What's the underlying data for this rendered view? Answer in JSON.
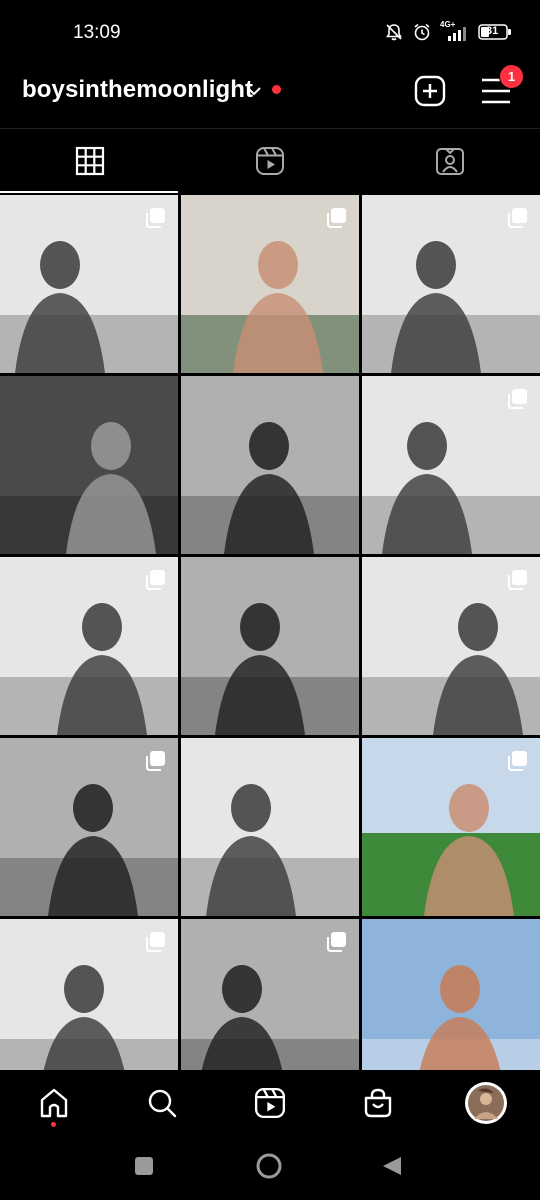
{
  "status_bar": {
    "time": "13:09",
    "network": "4G+",
    "battery": "31",
    "icons": [
      "bell-muted-icon",
      "alarm-icon",
      "signal-icon",
      "battery-icon"
    ]
  },
  "header": {
    "username": "boysinthemoonlight",
    "notification_count": "1",
    "icons": [
      "chevron-down-icon",
      "create-post-icon",
      "menu-icon"
    ]
  },
  "tabs": [
    {
      "icon": "grid-icon",
      "active": true
    },
    {
      "icon": "reels-icon",
      "active": false
    },
    {
      "icon": "tagged-icon",
      "active": false
    }
  ],
  "posts": [
    {
      "tone": "light-gray",
      "multi": true
    },
    {
      "tone": "color-warm",
      "multi": true
    },
    {
      "tone": "light-gray",
      "multi": true
    },
    {
      "tone": "dark-gray",
      "multi": false
    },
    {
      "tone": "mid-gray",
      "multi": false
    },
    {
      "tone": "light-gray",
      "multi": true
    },
    {
      "tone": "light-gray",
      "multi": true
    },
    {
      "tone": "mid-gray",
      "multi": false
    },
    {
      "tone": "light-gray",
      "multi": true
    },
    {
      "tone": "mid-gray",
      "multi": true
    },
    {
      "tone": "light-gray",
      "multi": false
    },
    {
      "tone": "color-field",
      "multi": true
    },
    {
      "tone": "light-gray",
      "multi": true
    },
    {
      "tone": "mid-gray",
      "multi": true
    },
    {
      "tone": "color-sky",
      "multi": false
    }
  ],
  "bottom_nav": [
    {
      "icon": "home-icon",
      "active": true
    },
    {
      "icon": "search-icon",
      "active": false
    },
    {
      "icon": "reels-icon",
      "active": false
    },
    {
      "icon": "shop-icon",
      "active": false
    },
    {
      "icon": "profile-avatar",
      "active": false
    }
  ],
  "system_nav": [
    "recents-button",
    "home-button",
    "back-button"
  ]
}
